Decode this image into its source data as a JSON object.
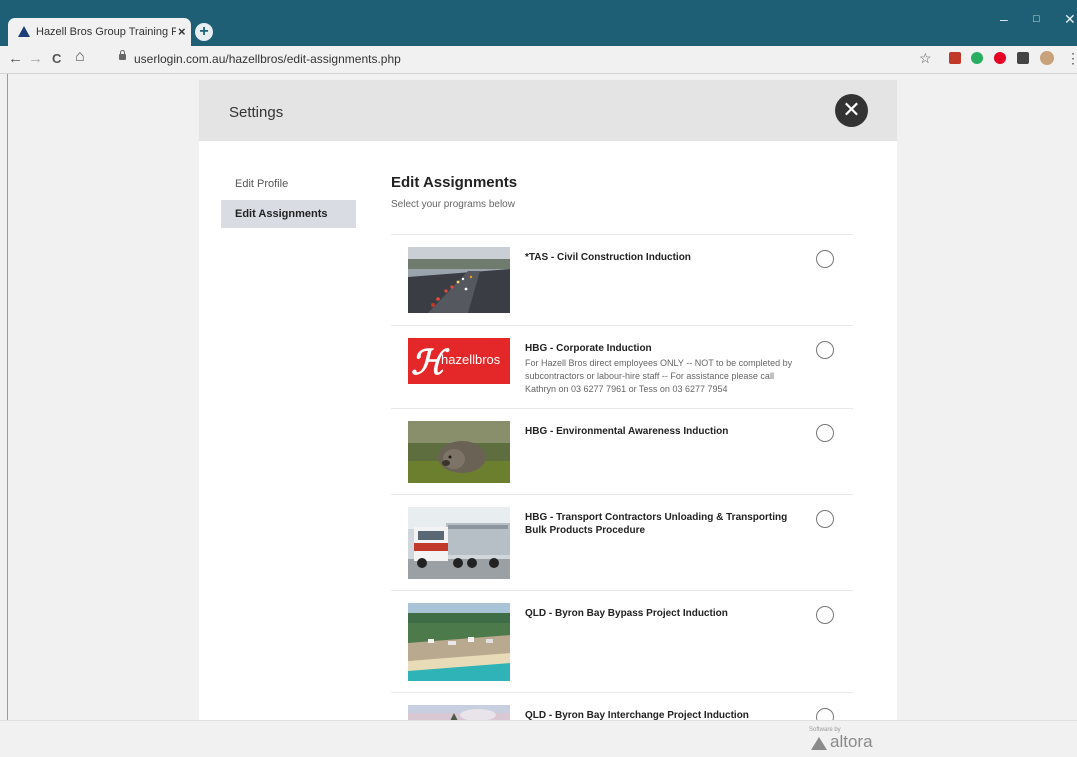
{
  "browser": {
    "tab_title": "Hazell Bros Group Training Platfo",
    "tab_close": "×",
    "new_tab": "+",
    "url": "userlogin.com.au/hazellbros/edit-assignments.php",
    "back": "←",
    "forward": "→",
    "reload": "C",
    "home": "⌂",
    "bookmark": "☆",
    "menu": "⋮",
    "minimize": "–",
    "maximize": "□",
    "close": "✕"
  },
  "settings": {
    "title": "Settings",
    "close_label": "✕",
    "sidebar": [
      {
        "label": "Edit Profile",
        "active": false
      },
      {
        "label": "Edit Assignments",
        "active": true
      }
    ],
    "heading": "Edit Assignments",
    "subheading": "Select your programs below"
  },
  "programs": [
    {
      "title": "*TAS - Civil Construction Induction",
      "description": "",
      "image": "highway-traffic"
    },
    {
      "title": "HBG - Corporate Induction",
      "description": "For Hazell Bros direct employees ONLY -- NOT to be completed by subcontractors or labour-hire staff -- For assistance please call Kathryn on 03 6277 7961 or Tess on 03 6277 7954",
      "image": "hazellbros-logo"
    },
    {
      "title": "HBG - Environmental Awareness Induction",
      "description": "",
      "image": "wombat"
    },
    {
      "title": "HBG - Transport Contractors Unloading & Transporting Bulk Products Procedure",
      "description": "",
      "image": "truck"
    },
    {
      "title": "QLD - Byron Bay Bypass Project Induction",
      "description": "",
      "image": "coastal-town"
    },
    {
      "title": "QLD - Byron Bay Interchange Project Induction",
      "description": "",
      "image": "sky"
    }
  ],
  "logo_text": "hazellbros",
  "footer": {
    "software_by": "Software by",
    "brand": "altora"
  },
  "colors": {
    "titlebar": "#1e5f75",
    "brand_red": "#e42728",
    "close_button": "#333333"
  }
}
